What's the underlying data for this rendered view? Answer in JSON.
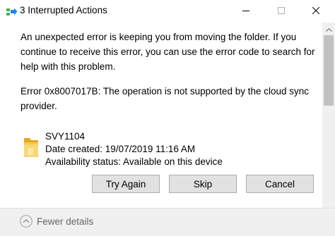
{
  "window": {
    "title": "3 Interrupted Actions",
    "controls": {
      "minimize_icon": "minimize-icon",
      "maximize_icon": "maximize-icon",
      "close_icon": "close-icon"
    }
  },
  "message": {
    "line1": "An unexpected error is keeping you from moving the folder. If you continue to receive this error, you can use the error code to search for help with this problem.",
    "line2": "Error 0x8007017B: The operation is not supported by the cloud sync provider."
  },
  "file": {
    "name": "SVY1104",
    "date_created": "Date created: 19/07/2019 11:16 AM",
    "availability": "Availability status: Available on this device",
    "icon": "folder-icon"
  },
  "buttons": {
    "try_again": "Try Again",
    "skip": "Skip",
    "cancel": "Cancel"
  },
  "footer": {
    "fewer_details": "Fewer details",
    "icon": "chevron-up-circle-icon"
  },
  "colors": {
    "button_bg": "#e1e1e1",
    "button_border": "#adadad",
    "footer_bg": "#f0f0f0",
    "footer_text": "#666666",
    "folder_yellow": "#f8d775"
  }
}
